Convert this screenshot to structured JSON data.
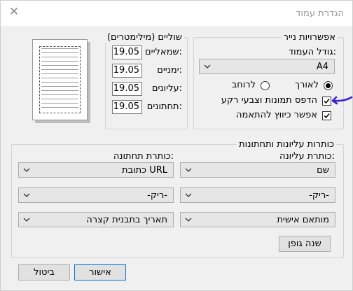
{
  "window": {
    "title": "הגדרת עמוד"
  },
  "paper": {
    "group_label": "אפשרויות נייר",
    "page_size_label": "גודל העמוד:",
    "page_size_value": "A4",
    "portrait_label": "לאורך",
    "landscape_label": "לרוחב",
    "orientation_selected": "portrait",
    "print_background_label": "הדפס תמונות וצבעי רקע",
    "print_background_checked": true,
    "shrink_to_fit_label": "אפשר כיווץ להתאמה",
    "shrink_to_fit_checked": true
  },
  "margins": {
    "group_label": "שוליים (מילימטרים)",
    "left_label": "שמאליים:",
    "left_value": "19.05",
    "right_label": "ימניים:",
    "right_value": "19.05",
    "top_label": "עליונים:",
    "top_value": "19.05",
    "bottom_label": "תחתונים:",
    "bottom_value": "19.05"
  },
  "headers_footers": {
    "group_label": "כותרות עליונות ותחתונות",
    "header_label": "כותרת עליונה:",
    "footer_label": "כותרת תחתונה:",
    "header_row1": "שם",
    "header_row2": "-ריק-",
    "header_row3": "מותאם אישית",
    "footer_row1": "כתובת URL",
    "footer_row2": "-ריק-",
    "footer_row3": "תאריך בתבנית קצרה",
    "change_font_label": "שנה גופן"
  },
  "buttons": {
    "ok": "אישור",
    "cancel": "ביטול"
  },
  "icons": {
    "close": "close-icon",
    "chevron": "chevron-down-icon",
    "annotation": "annotation-arrow-icon",
    "annotation_color": "#3b1fd1"
  }
}
